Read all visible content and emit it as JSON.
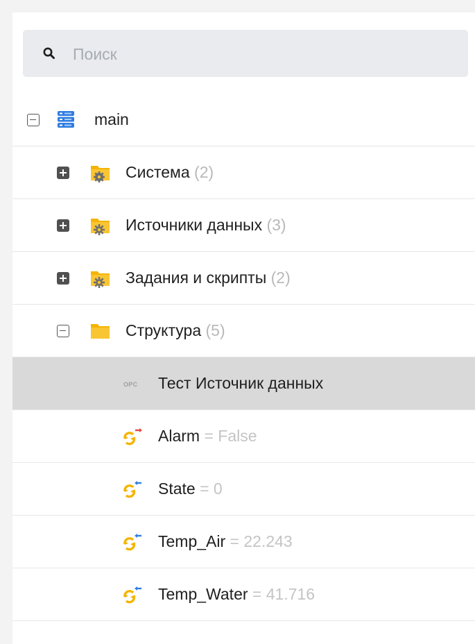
{
  "search": {
    "placeholder": "Поиск",
    "icon": "search-icon"
  },
  "tree": {
    "root": {
      "label": "main",
      "icon": "server-icon",
      "expanded": true
    },
    "folders": [
      {
        "label": "Система",
        "count": "(2)",
        "expanded": false,
        "icon": "folder-gear-icon"
      },
      {
        "label": "Источники данных",
        "count": "(3)",
        "expanded": false,
        "icon": "folder-gear-icon"
      },
      {
        "label": "Задания и скрипты",
        "count": "(2)",
        "expanded": false,
        "icon": "folder-gear-icon"
      },
      {
        "label": "Структура",
        "count": "(5)",
        "expanded": true,
        "icon": "folder-icon"
      }
    ],
    "children": [
      {
        "label": "Тест Источник данных",
        "badge": "OPC",
        "selected": true
      },
      {
        "label": "Alarm",
        "value": "= False",
        "icon": "tag-output-icon"
      },
      {
        "label": "State",
        "value": "= 0",
        "icon": "tag-input-icon"
      },
      {
        "label": "Temp_Air",
        "value": "= 22.243",
        "icon": "tag-input-icon"
      },
      {
        "label": "Temp_Water",
        "value": "= 41.716",
        "icon": "tag-input-icon"
      }
    ]
  },
  "colors": {
    "selected_row": "#d9d9d9",
    "folder": "#f5b400",
    "server": "#2f7de1",
    "tag_blue_arrow": "#2f7de1",
    "tag_red_arrow": "#e8463a",
    "muted_text": "#b9b9b9"
  }
}
